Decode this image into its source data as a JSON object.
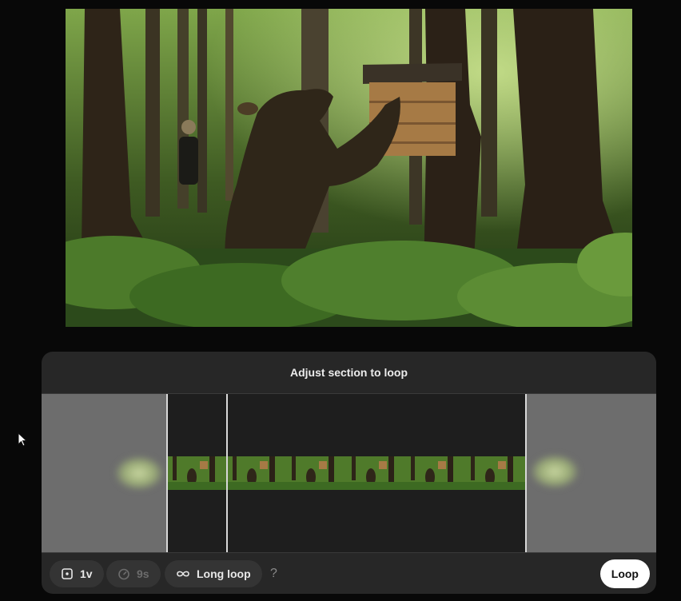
{
  "editor": {
    "title": "Adjust section to loop"
  },
  "controls": {
    "version_label": "1v",
    "duration_label": "9s",
    "mode_label": "Long loop",
    "help_label": "?",
    "loop_button_label": "Loop"
  },
  "icons": {
    "version": "square-dot-icon",
    "duration": "stopwatch-icon",
    "mode": "infinity-icon",
    "cursor": "mouse-pointer-icon"
  },
  "colors": {
    "background": "#080808",
    "panel": "#272727",
    "pill": "#343434",
    "primary_button": "#ffffff"
  }
}
